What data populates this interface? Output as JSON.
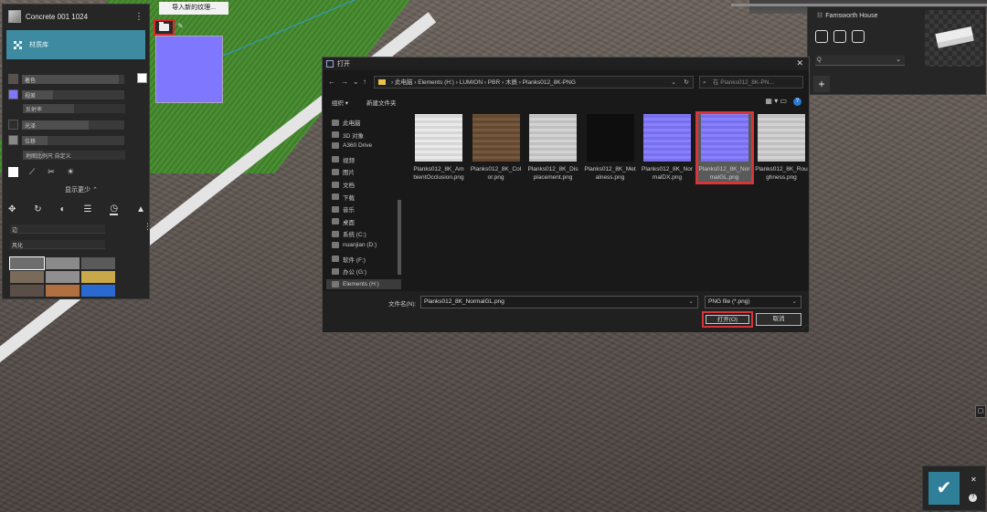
{
  "colors": {
    "accent_teal": "#3e8aa0",
    "highlight_red": "#d8343a",
    "normal_map": "#7f78ff"
  },
  "material_panel": {
    "title": "Concrete 001 1024",
    "library_button": "材质库",
    "props": [
      {
        "label": "着色",
        "swatch": "#5a4f4a",
        "level": 0.95
      },
      {
        "label": "视差",
        "swatch": "#7f78ff",
        "level": 0.3
      },
      {
        "label": "反射率",
        "level": 0.5,
        "sub": true
      },
      {
        "label": "光泽",
        "swatch": "#2e2e2e",
        "level": 0.65
      },
      {
        "label": "位移",
        "swatch": "#888888",
        "level": 0.25
      },
      {
        "label": "地图比例尺 自定义",
        "level": 0.2,
        "sub": true
      }
    ],
    "show_less": "显示更少 ⌃",
    "category_1": "边",
    "category_2": "风化",
    "thumb_colors": [
      "#6d6d6d",
      "#8a8a8a",
      "#5a5a5a",
      "#7a6a5a",
      "#8f8f8f",
      "#c9a84a",
      "#5a4f48",
      "#b07040",
      "#2a6ad0"
    ]
  },
  "texture_popup": {
    "import_label": "导入新的纹理..."
  },
  "house_panel": {
    "title": "Farnsworth House",
    "select_value": "Q",
    "add_label": "+"
  },
  "dialog": {
    "title": "打开",
    "breadcrumb": "›  此电脑  ›  Elements (H:)  ›  LUMION  ›  PBR  ›  木质  ›  Planks012_8K-PNG",
    "search_placeholder": "在 Planks012_8K-PN...",
    "organize": "组织 ▾",
    "new_folder": "新建文件夹",
    "nav_items": [
      "此电脑",
      "3D 对象",
      "A360 Drive",
      "视频",
      "图片",
      "文档",
      "下载",
      "音乐",
      "桌面",
      "系统 (C:)",
      "nuanjian (D:)",
      "软件 (F:)",
      "办公 (G:)",
      "Elements (H:)"
    ],
    "files": [
      {
        "name": "Planks012_8K_AmbientOcclusion.png",
        "color": "#e8e8e8"
      },
      {
        "name": "Planks012_8K_Color.png",
        "color": "#6b4e33"
      },
      {
        "name": "Planks012_8K_Displacement.png",
        "color": "#d0d0d0"
      },
      {
        "name": "Planks012_8K_Metalness.png",
        "color": "#0e0e0e"
      },
      {
        "name": "Planks012_8K_NormalDX.png",
        "color": "#8278ff"
      },
      {
        "name": "Planks012_8K_NormalGL.png",
        "color": "#8278ff"
      },
      {
        "name": "Planks012_8K_Roughness.png",
        "color": "#cfcfcf"
      }
    ],
    "filename_label": "文件名(N):",
    "filename_value": "Planks012_8K_NormalGL.png",
    "filetype_value": "PNG file (*.png)",
    "open_label": "打开(O)",
    "cancel_label": "取消"
  },
  "confirm": {
    "ok_symbol": "✔",
    "close_symbol": "✕",
    "help_symbol": "?"
  }
}
